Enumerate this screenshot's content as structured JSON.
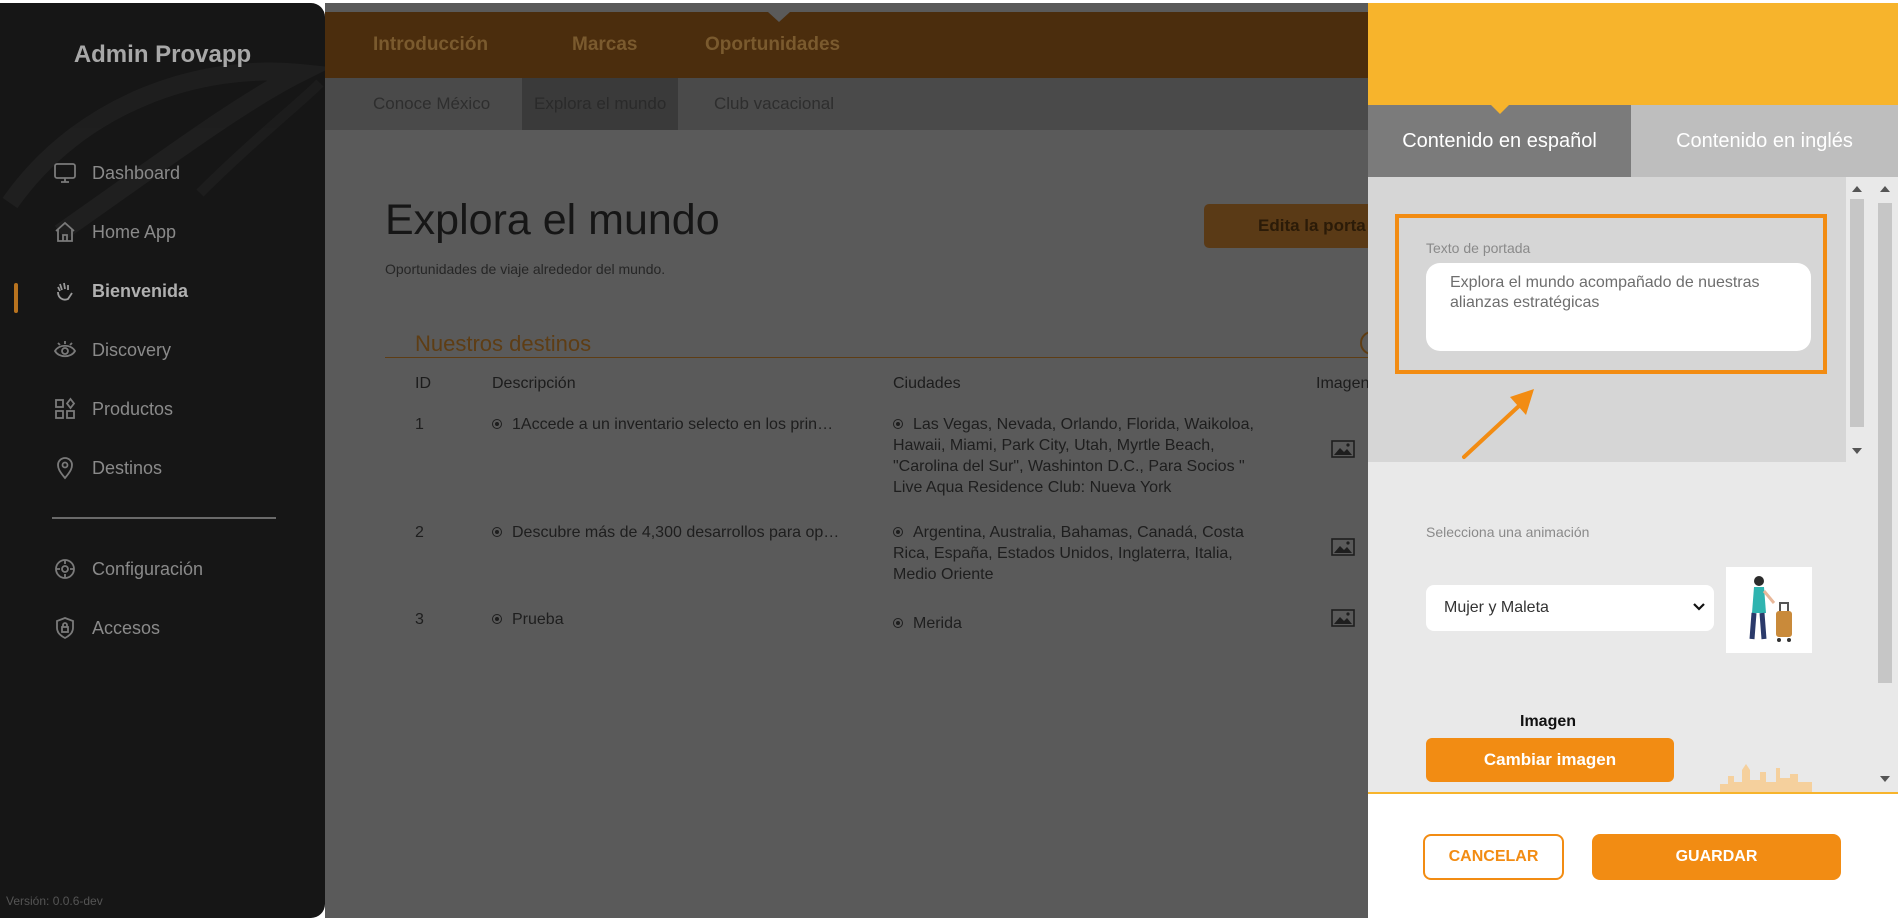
{
  "sidebar": {
    "brand": "Admin Provapp",
    "items": [
      {
        "label": "Dashboard",
        "icon": "monitor-icon"
      },
      {
        "label": "Home App",
        "icon": "home-icon"
      },
      {
        "label": "Bienvenida",
        "icon": "wave-hand-icon",
        "active": true
      },
      {
        "label": "Discovery",
        "icon": "eye-icon"
      },
      {
        "label": "Productos",
        "icon": "grid-icon"
      },
      {
        "label": "Destinos",
        "icon": "map-pin-icon"
      }
    ],
    "settings": [
      {
        "label": "Configuración",
        "icon": "gear-icon"
      },
      {
        "label": "Accesos",
        "icon": "shield-lock-icon"
      }
    ],
    "version": "Versión: 0.0.6-dev"
  },
  "topnav": {
    "tabs": [
      "Introducción",
      "Marcas",
      "Oportunidades"
    ]
  },
  "subnav": {
    "tabs": [
      "Conoce México",
      "Explora el mundo",
      "Club vacacional"
    ],
    "active": "Explora el mundo"
  },
  "page": {
    "title": "Explora el mundo",
    "subtitle": "Oportunidades de viaje alrededor del mundo.",
    "edit_button": "Edita la porta",
    "section_title": "Nuestros destinos"
  },
  "table": {
    "headers": [
      "ID",
      "Descripción",
      "Ciudades",
      "Imagen"
    ],
    "rows": [
      {
        "id": "1",
        "description": "1Accede a un inventario selecto en los prin…",
        "cities": [
          "Las Vegas, Nevada, Orlando, Florida, Waikoloa,",
          "Hawaii, Miami, Park City, Utah, Myrtle Beach,",
          "\"Carolina del Sur\", Washinton D.C., Para Socios \"",
          "Live Aqua Residence Club: Nueva York"
        ]
      },
      {
        "id": "2",
        "description": "Descubre más de 4,300 desarrollos para op…",
        "cities": [
          "Argentina, Australia, Bahamas, Canadá, Costa",
          "Rica, España, Estados Unidos, Inglaterra, Italia,",
          "Medio Oriente"
        ]
      },
      {
        "id": "3",
        "description": "Prueba",
        "cities": [
          "Merida"
        ]
      }
    ]
  },
  "panel": {
    "tabs": [
      "Contenido en español",
      "Contenido en inglés"
    ],
    "cover_text_label": "Texto de portada",
    "cover_text_value": "Explora el mundo acompañado de nuestras alianzas estratégicas",
    "animation_label": "Selecciona una animación",
    "animation_selected": "Mujer y Maleta",
    "image_label": "Imagen",
    "change_image_button": "Cambiar imagen",
    "cancel_button": "CANCELAR",
    "save_button": "GUARDAR"
  },
  "colors": {
    "accent": "#f28c13",
    "header_yellow": "#f7b42c",
    "sidebar_bg": "#161616"
  }
}
